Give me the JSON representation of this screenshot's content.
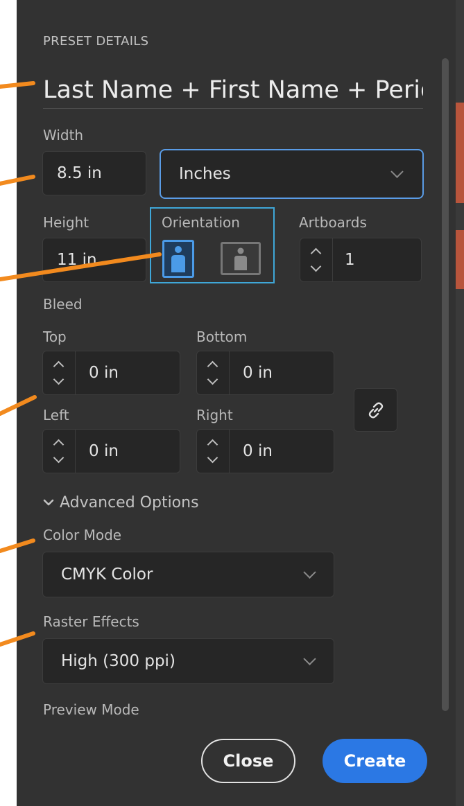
{
  "preset": {
    "section_title": "PRESET DETAILS",
    "name": "Last Name + First Name + Period"
  },
  "width": {
    "label": "Width",
    "value": "8.5 in",
    "unit": "Inches"
  },
  "height": {
    "label": "Height",
    "value": "11 in"
  },
  "orientation": {
    "label": "Orientation",
    "selected": "portrait"
  },
  "artboards": {
    "label": "Artboards",
    "value": "1"
  },
  "bleed": {
    "label": "Bleed",
    "top_label": "Top",
    "top_value": "0 in",
    "bottom_label": "Bottom",
    "bottom_value": "0 in",
    "left_label": "Left",
    "left_value": "0 in",
    "right_label": "Right",
    "right_value": "0 in"
  },
  "advanced": {
    "label": "Advanced Options",
    "color_mode_label": "Color Mode",
    "color_mode_value": "CMYK Color",
    "raster_label": "Raster Effects",
    "raster_value": "High (300 ppi)",
    "preview_label": "Preview Mode"
  },
  "buttons": {
    "close": "Close",
    "create": "Create"
  },
  "colors": {
    "panel_bg": "#323232",
    "field_bg": "#262626",
    "accent_blue": "#2b78e4",
    "focus_blue": "#5a9ce6",
    "annotation_orange": "#f28a1e"
  },
  "icons": [
    "portrait-orientation-icon",
    "landscape-orientation-icon",
    "link-icon",
    "chevron-down-icon",
    "stepper-up-icon",
    "stepper-down-icon"
  ]
}
